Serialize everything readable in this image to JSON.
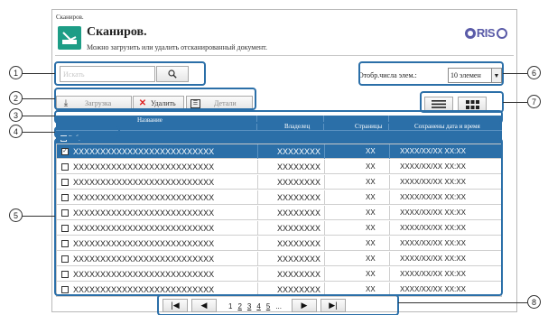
{
  "breadcrumb": "Сканиров.",
  "app": {
    "title": "Сканиров.",
    "description": "Можно загрузить или удалить отсканированный документ.",
    "logo_text": "RIS"
  },
  "search": {
    "placeholder": "Искать"
  },
  "items_per_page": {
    "label": "Отобр.числа элем.:",
    "value": "10 элемен"
  },
  "toolbar": {
    "download": "Загрузка",
    "delete": "Удалить",
    "details": "Детали"
  },
  "table": {
    "columns": {
      "name": "Название",
      "owner": "Владелец",
      "pages": "Страницы",
      "date": "Сохранены дата и время"
    },
    "select_all_label": "Выбрать все",
    "rows": [
      {
        "checked": true,
        "name": "XXXXXXXXXXXXXXXXXXXXXXXXXX",
        "owner": "XXXXXXXX",
        "pages": "XX",
        "date": "XXXX/XX/XX XX:XX"
      },
      {
        "checked": false,
        "name": "XXXXXXXXXXXXXXXXXXXXXXXXXX",
        "owner": "XXXXXXXX",
        "pages": "XX",
        "date": "XXXX/XX/XX XX:XX"
      },
      {
        "checked": false,
        "name": "XXXXXXXXXXXXXXXXXXXXXXXXXX",
        "owner": "XXXXXXXX",
        "pages": "XX",
        "date": "XXXX/XX/XX XX:XX"
      },
      {
        "checked": false,
        "name": "XXXXXXXXXXXXXXXXXXXXXXXXXX",
        "owner": "XXXXXXXX",
        "pages": "XX",
        "date": "XXXX/XX/XX XX:XX"
      },
      {
        "checked": false,
        "name": "XXXXXXXXXXXXXXXXXXXXXXXXXX",
        "owner": "XXXXXXXX",
        "pages": "XX",
        "date": "XXXX/XX/XX XX:XX"
      },
      {
        "checked": false,
        "name": "XXXXXXXXXXXXXXXXXXXXXXXXXX",
        "owner": "XXXXXXXX",
        "pages": "XX",
        "date": "XXXX/XX/XX XX:XX"
      },
      {
        "checked": false,
        "name": "XXXXXXXXXXXXXXXXXXXXXXXXXX",
        "owner": "XXXXXXXX",
        "pages": "XX",
        "date": "XXXX/XX/XX XX:XX"
      },
      {
        "checked": false,
        "name": "XXXXXXXXXXXXXXXXXXXXXXXXXX",
        "owner": "XXXXXXXX",
        "pages": "XX",
        "date": "XXXX/XX/XX XX:XX"
      },
      {
        "checked": false,
        "name": "XXXXXXXXXXXXXXXXXXXXXXXXXX",
        "owner": "XXXXXXXX",
        "pages": "XX",
        "date": "XXXX/XX/XX XX:XX"
      },
      {
        "checked": false,
        "name": "XXXXXXXXXXXXXXXXXXXXXXXXXX",
        "owner": "XXXXXXXX",
        "pages": "XX",
        "date": "XXXX/XX/XX XX:XX"
      }
    ]
  },
  "pagination": {
    "pages": [
      "1",
      "2",
      "3",
      "4",
      "5"
    ],
    "more": "..."
  },
  "callouts": [
    "1",
    "2",
    "3",
    "4",
    "5",
    "6",
    "7",
    "8"
  ],
  "icons": {
    "app": "scanner-icon",
    "search": "search-icon",
    "download": "download-icon",
    "delete": "delete-x-icon",
    "details": "details-list-icon",
    "view_list": "list-view-icon",
    "view_grid": "grid-view-icon",
    "first": "first-page-icon",
    "prev": "prev-page-icon",
    "next": "next-page-icon",
    "last": "last-page-icon"
  },
  "colors": {
    "header_blue": "#2b6fa8",
    "accent_green": "#1d9d86",
    "logo_purple": "#5a5ba8",
    "delete_red": "#d22222"
  }
}
